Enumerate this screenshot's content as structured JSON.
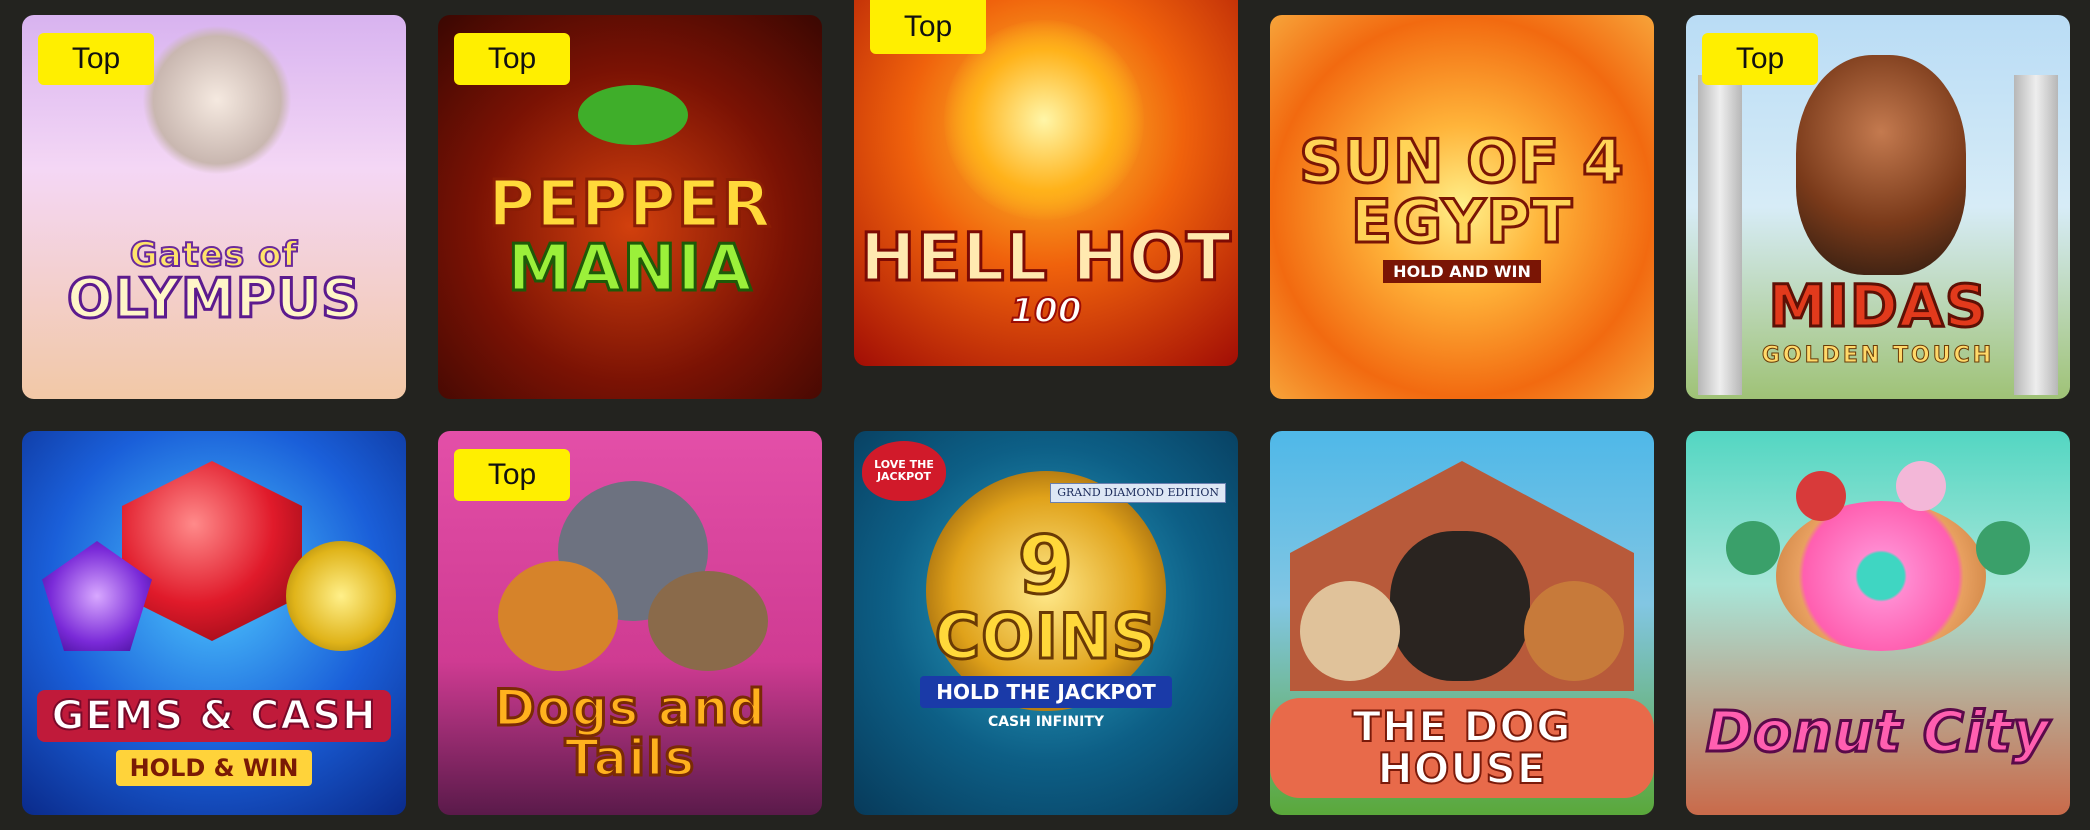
{
  "badge_label": "Top",
  "games": [
    {
      "title": "Gates of",
      "title2": "OLYMPUS",
      "top": true
    },
    {
      "title": "PEPPER",
      "title2": "MANIA",
      "top": true
    },
    {
      "title": "HELL HOT",
      "subtitle": "100",
      "top": true
    },
    {
      "title": "SUN OF 4",
      "title2": "EGYPT",
      "subtitle": "HOLD AND WIN",
      "top": false
    },
    {
      "title": "MIDAS",
      "subtitle": "GOLDEN TOUCH",
      "top": true
    },
    {
      "title": "GEMS & CASH",
      "subtitle": "HOLD & WIN",
      "top": false
    },
    {
      "title": "Dogs and Tails",
      "top": true
    },
    {
      "title": "9",
      "title2": "COINS",
      "subtitle": "HOLD THE JACKPOT",
      "subtitle2": "CASH INFINITY",
      "badge1": "LOVE THE JACKPOT",
      "badge2": "GRAND DIAMOND EDITION",
      "top": false
    },
    {
      "title": "THE DOG HOUSE",
      "top": false
    },
    {
      "title": "Donut City",
      "top": false
    }
  ]
}
